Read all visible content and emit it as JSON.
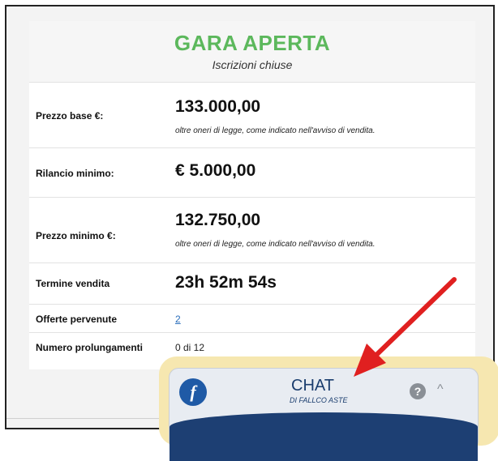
{
  "status": {
    "title": "GARA APERTA",
    "subtitle": "Iscrizioni chiuse"
  },
  "rows": {
    "prezzo_base": {
      "label": "Prezzo base €:",
      "value": "133.000,00",
      "note": "oltre oneri di legge, come indicato nell'avviso di vendita."
    },
    "rilancio": {
      "label": "Rilancio minimo:",
      "value": "€ 5.000,00"
    },
    "prezzo_minimo": {
      "label": "Prezzo minimo €:",
      "value": "132.750,00",
      "note": "oltre oneri di legge, come indicato nell'avviso di vendita."
    },
    "termine": {
      "label": "Termine vendita",
      "value": "23h 52m 54s"
    },
    "offerte": {
      "label": "Offerte pervenute",
      "value": "2"
    },
    "prolungamenti": {
      "label": "Numero prolungamenti",
      "value": "0 di 12"
    }
  },
  "chat": {
    "title": "CHAT",
    "subtitle": "DI FALLCO ASTE",
    "logo": "f",
    "help_glyph": "?",
    "chevron_glyph": "^"
  },
  "colors": {
    "status_green": "#5cb85c",
    "arrow_red": "#e02020",
    "chat_navy": "#1d3f73",
    "highlight_yellow": "#f6e7b0"
  },
  "icons": [
    "fallco-logo-icon",
    "help-icon",
    "chevron-up-icon",
    "red-arrow-annotation"
  ]
}
